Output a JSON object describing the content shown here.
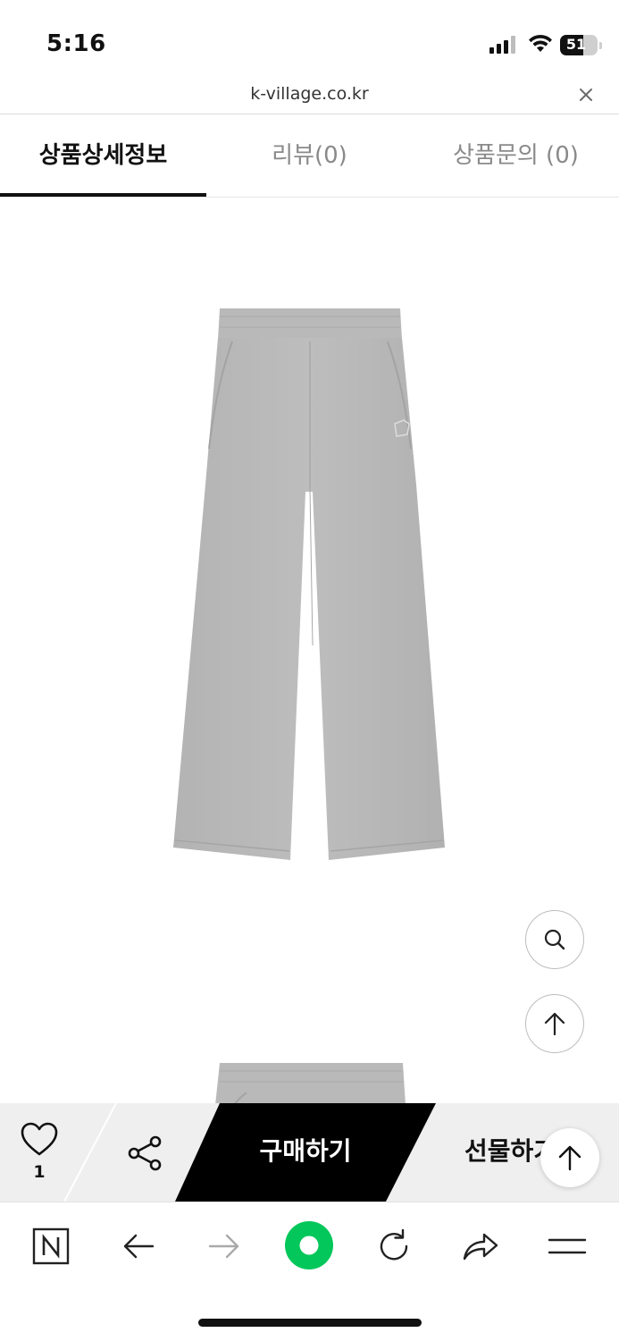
{
  "status_bar": {
    "time": "5:16",
    "battery_level": "51"
  },
  "url_bar": {
    "url": "k-village.co.kr"
  },
  "tabs": [
    {
      "label": "상품상세정보",
      "active": true
    },
    {
      "label": "리뷰(0)",
      "active": false
    },
    {
      "label": "상품문의 (0)",
      "active": false
    }
  ],
  "product": {
    "image_icon": "gray-sweatpants-image",
    "color": "#b7b7b7"
  },
  "floating_buttons": {
    "zoom_icon": "magnifier-icon",
    "top_icon": "arrow-up-icon"
  },
  "purchase_bar": {
    "like_count": "1",
    "buy_label": "구매하기",
    "gift_label": "선물하기"
  },
  "toolbar": {
    "items": [
      "naver-n-icon",
      "back-arrow-icon",
      "forward-arrow-icon",
      "home-green-circle-icon",
      "reload-icon",
      "share-arrow-icon",
      "menu-icon"
    ],
    "accent": "#03c75a"
  }
}
